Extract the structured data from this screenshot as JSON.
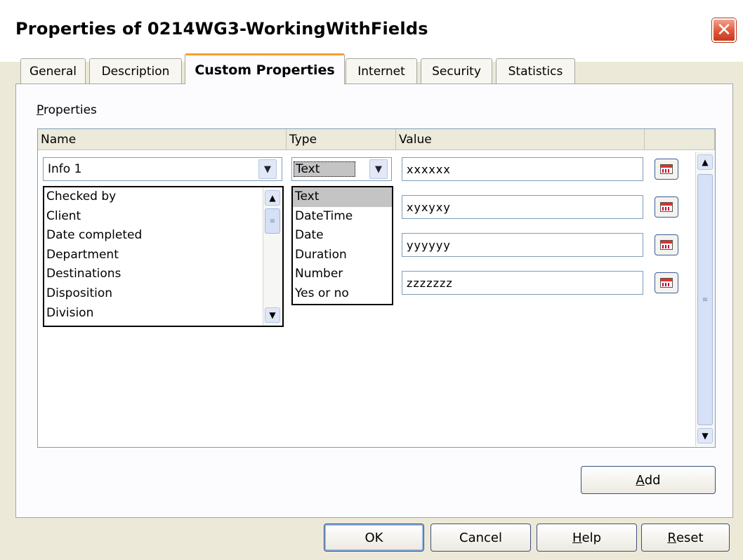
{
  "window": {
    "title": "Properties of 0214WG3-WorkingWithFields",
    "close_glyph": "✕"
  },
  "tabs": [
    {
      "label": "General",
      "active": false
    },
    {
      "label": "Description",
      "active": false
    },
    {
      "label": "Custom Properties",
      "active": true
    },
    {
      "label": "Internet",
      "active": false
    },
    {
      "label": "Security",
      "active": false
    },
    {
      "label": "Statistics",
      "active": false
    }
  ],
  "properties": {
    "section_label_underlined": "P",
    "section_label_rest": "roperties",
    "columns": {
      "name": "Name",
      "type": "Type",
      "value": "Value"
    },
    "name_combo_value": "Info 1",
    "type_combo_value": "Text",
    "values": [
      "xxxxxx",
      "xyxyxy",
      "yyyyyy",
      "zzzzzzz"
    ],
    "name_options": [
      "Checked by",
      "Client",
      "Date completed",
      "Department",
      "Destinations",
      "Disposition",
      "Division"
    ],
    "type_options": [
      "Text",
      "DateTime",
      "Date",
      "Duration",
      "Number",
      "Yes or no"
    ],
    "type_selected": "Text"
  },
  "icons": {
    "dropdown": "chevron-down-icon",
    "calendar": "calendar-icon",
    "scroll_up": "arrow-up-icon",
    "scroll_down": "arrow-down-icon"
  },
  "buttons": {
    "add_underlined": "A",
    "add_rest": "dd",
    "ok": "OK",
    "cancel": "Cancel",
    "help_underlined": "H",
    "help_rest": "elp",
    "reset_underlined": "R",
    "reset_rest": "eset"
  },
  "colors": {
    "tab_accent": "#f2a133",
    "close_button": "#e0563a",
    "dialog_bg": "#ece9d8"
  }
}
